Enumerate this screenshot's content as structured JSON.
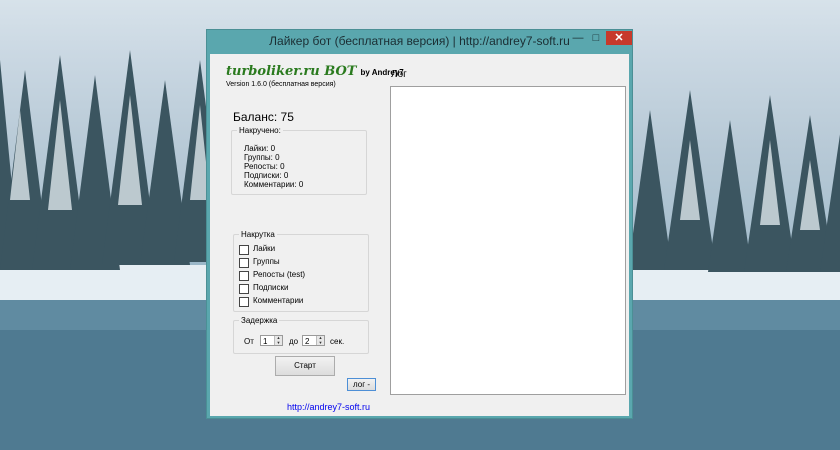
{
  "window": {
    "title": "Лайкер бот (бесплатная версия) | http://andrey7-soft.ru",
    "controls": {
      "minimize": "—",
      "maximize": "□",
      "close": "✕"
    }
  },
  "app": {
    "logo": "turboliker.ru BOT",
    "logo_by": "by Andrey7",
    "version": "Version 1.6.0 (бесплатная версия)",
    "balance": "Баланс: 75"
  },
  "stats": {
    "title": "Накручено:",
    "lines": [
      "Лайки: 0",
      "Группы: 0",
      "Репосты: 0",
      "Подписки: 0",
      "Комментарии: 0"
    ]
  },
  "nakrutka": {
    "title": "Накрутка",
    "options": [
      {
        "label": "Лайки",
        "checked": false
      },
      {
        "label": "Группы",
        "checked": false
      },
      {
        "label": "Репосты (test)",
        "checked": false
      },
      {
        "label": "Подписки",
        "checked": false
      },
      {
        "label": "Комментарии",
        "checked": false
      }
    ]
  },
  "delay": {
    "title": "Задержка",
    "from_label": "От",
    "from_value": "1",
    "to_label": "до",
    "to_value": "2",
    "unit": "сек."
  },
  "buttons": {
    "start": "Старт",
    "log_toggle": "лог -"
  },
  "footer_link": "http://andrey7-soft.ru",
  "log": {
    "label": "Лог"
  }
}
